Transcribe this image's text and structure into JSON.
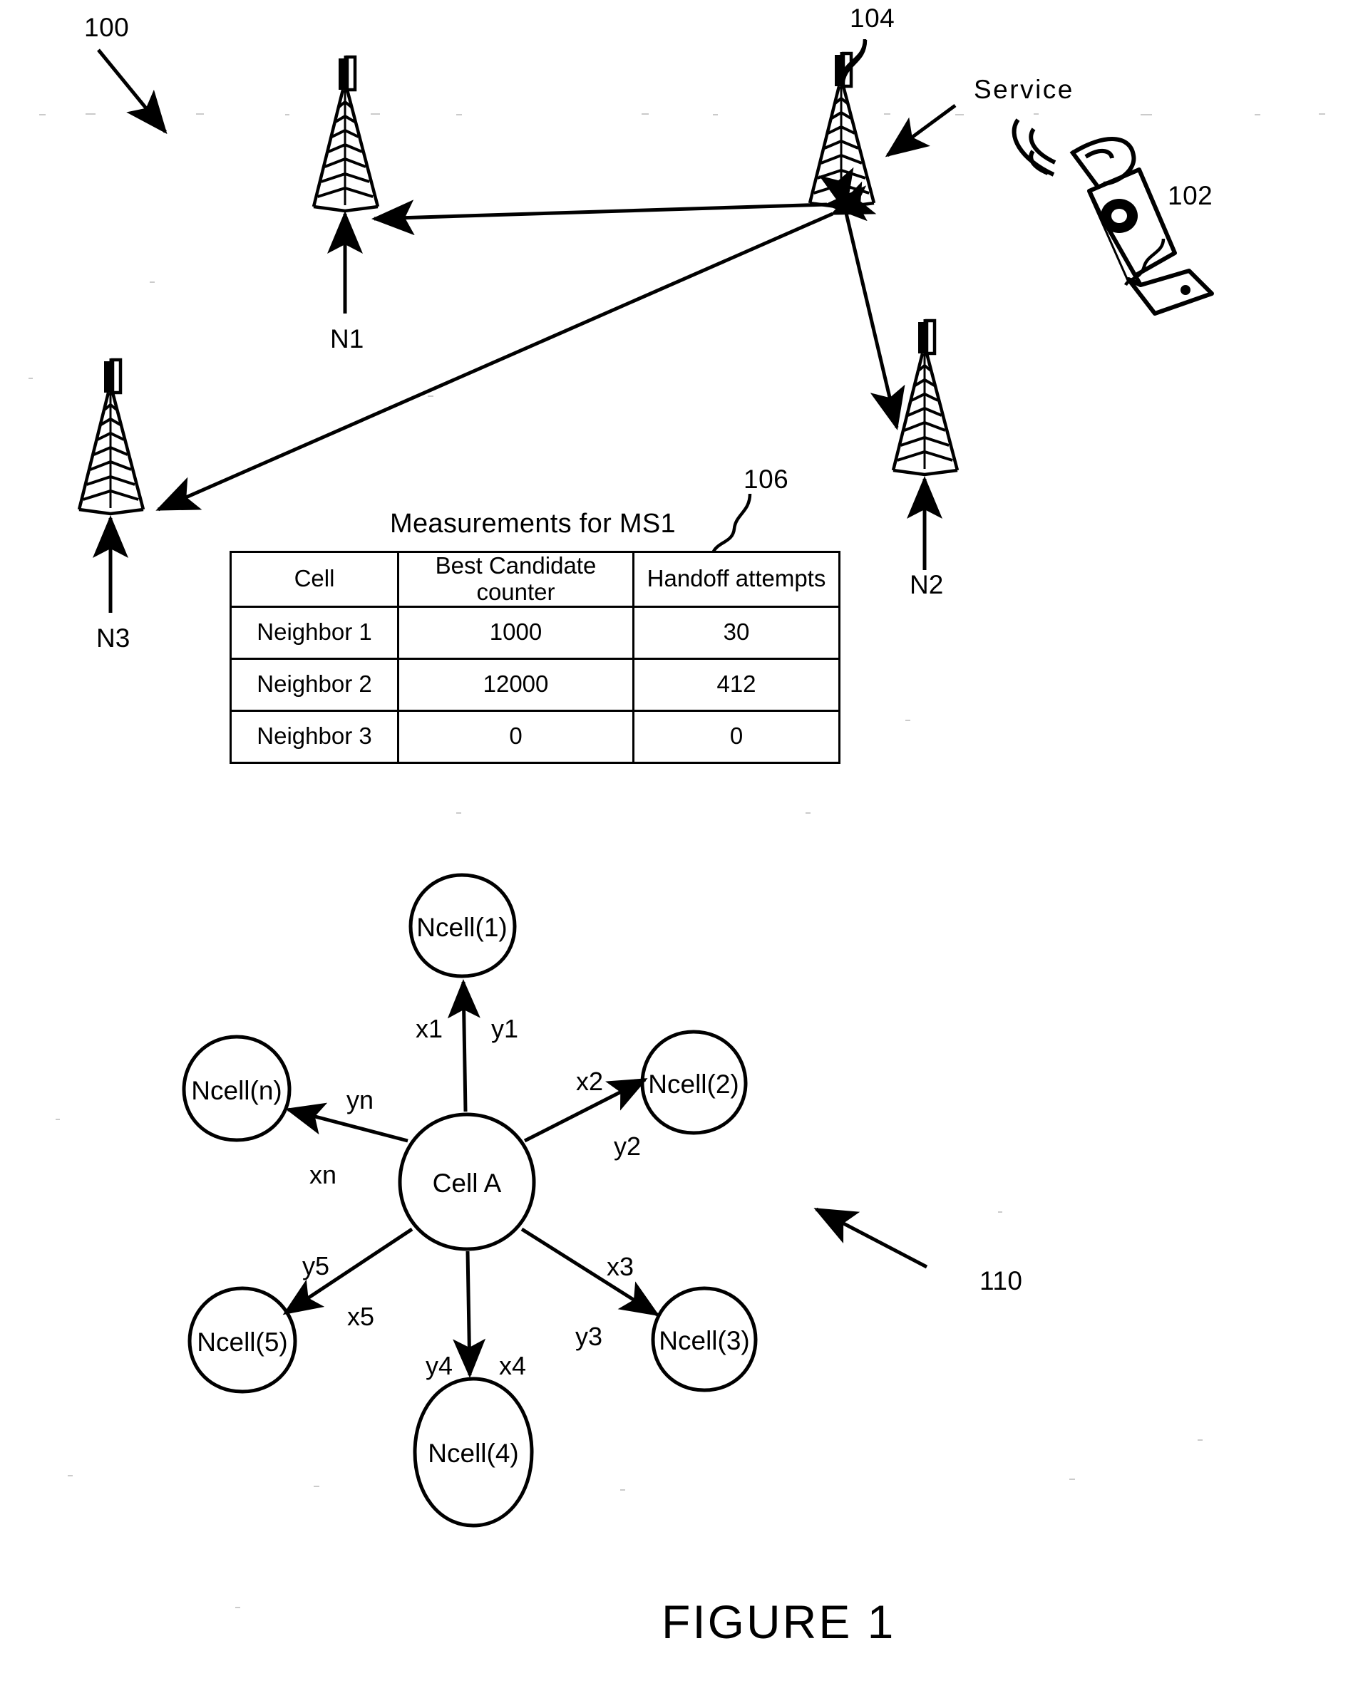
{
  "figure": {
    "caption": "FIGURE 1",
    "system_ref": "100"
  },
  "network": {
    "serving_tower": {
      "ref": "104",
      "label": "Service"
    },
    "mobile_station": {
      "ref": "102"
    },
    "neighbor_towers": [
      {
        "label": "N1"
      },
      {
        "label": "N2"
      },
      {
        "label": "N3"
      }
    ]
  },
  "measurements_table": {
    "ref": "106",
    "title": "Measurements for MS1",
    "columns": [
      "Cell",
      "Best Candidate counter",
      "Handoff attempts"
    ],
    "column_lines": [
      [
        "Cell"
      ],
      [
        "Best Candidate",
        "counter"
      ],
      [
        "Handoff attempts"
      ]
    ],
    "rows": [
      {
        "cell": "Neighbor 1",
        "best_candidate_counter": "1000",
        "handoff_attempts": "30"
      },
      {
        "cell": "Neighbor 2",
        "best_candidate_counter": "12000",
        "handoff_attempts": "412"
      },
      {
        "cell": "Neighbor 3",
        "best_candidate_counter": "0",
        "handoff_attempts": "0"
      }
    ]
  },
  "cell_graph": {
    "ref": "110",
    "center_node": "Cell A",
    "nodes": [
      {
        "id": "ncell1",
        "label": "Ncell(1)"
      },
      {
        "id": "ncell2",
        "label": "Ncell(2)"
      },
      {
        "id": "ncell3",
        "label": "Ncell(3)"
      },
      {
        "id": "ncell4",
        "label": "Ncell(4)"
      },
      {
        "id": "ncell5",
        "label": "Ncell(5)"
      },
      {
        "id": "ncelln",
        "label": "Ncell(n)"
      }
    ],
    "edge_labels": {
      "x1": "x1",
      "y1": "y1",
      "x2": "x2",
      "y2": "y2",
      "x3": "x3",
      "y3": "y3",
      "x4": "x4",
      "y4": "y4",
      "x5": "x5",
      "y5": "y5",
      "xn": "xn",
      "yn": "yn"
    }
  },
  "colors": {
    "ink": "#000000",
    "paper": "#ffffff"
  }
}
